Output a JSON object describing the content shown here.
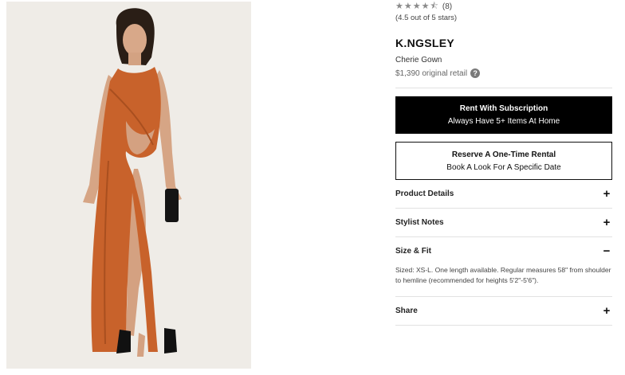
{
  "product": {
    "image_alt": "Model wearing orange cutout gown",
    "stars_display": "★★★★⯪",
    "review_count": "(8)",
    "rating_text": "(4.5 out of 5 stars)",
    "rating_value": 4.5,
    "brand": "K.NGSLEY",
    "name": "Cherie Gown",
    "price": "$1,390 original retail",
    "help_glyph": "?"
  },
  "buttons": {
    "subscription": {
      "line1": "Rent With Subscription",
      "line2": "Always Have 5+ Items At Home"
    },
    "one_time": {
      "line1": "Reserve A One-Time Rental",
      "line2": "Book A Look For A Specific Date"
    }
  },
  "accordion": {
    "product_details": {
      "label": "Product Details",
      "icon": "+"
    },
    "stylist_notes": {
      "label": "Stylist Notes",
      "icon": "+"
    },
    "size_fit": {
      "label": "Size & Fit",
      "icon": "−",
      "text": "Sized: XS-L. One length available. Regular measures 58\" from shoulder to hemline (recommended for heights 5'2\"-5'6\")."
    },
    "share": {
      "label": "Share",
      "icon": "+"
    }
  },
  "colors": {
    "dress": "#c8622b",
    "background": "#efece7",
    "button_dark": "#000000"
  }
}
